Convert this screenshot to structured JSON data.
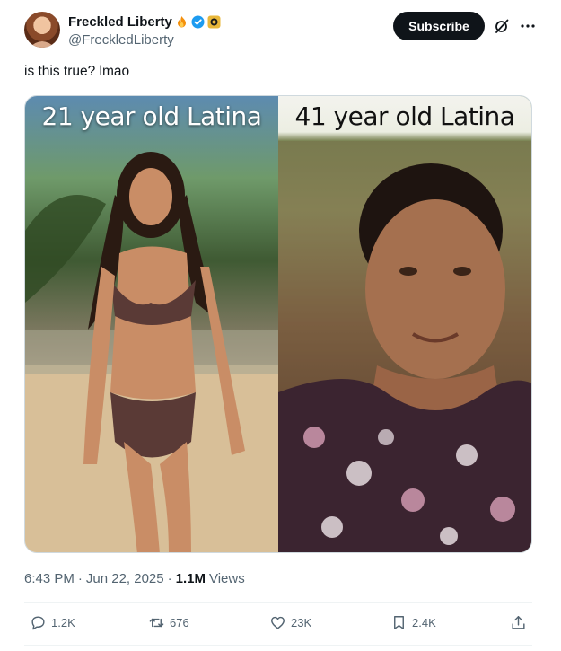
{
  "author": {
    "display_name": "Freckled Liberty",
    "handle": "@FreckledLiberty",
    "badges": [
      "fire-icon",
      "verified-icon",
      "gold-badge-icon"
    ]
  },
  "header": {
    "subscribe_label": "Subscribe"
  },
  "tweet": {
    "text": "is this true? lmao"
  },
  "media": {
    "left_caption": "21 year old Latina",
    "right_caption": "41 year old Latina"
  },
  "meta": {
    "time": "6:43 PM",
    "date": "Jun 22, 2025",
    "views_count": "1.1M",
    "views_label": "Views"
  },
  "actions": {
    "replies": "1.2K",
    "reposts": "676",
    "likes": "23K",
    "bookmarks": "2.4K"
  },
  "colors": {
    "text_primary": "#0f1419",
    "text_secondary": "#536471",
    "verified_blue": "#1d9bf0",
    "repost_green": "#00ba7c"
  }
}
